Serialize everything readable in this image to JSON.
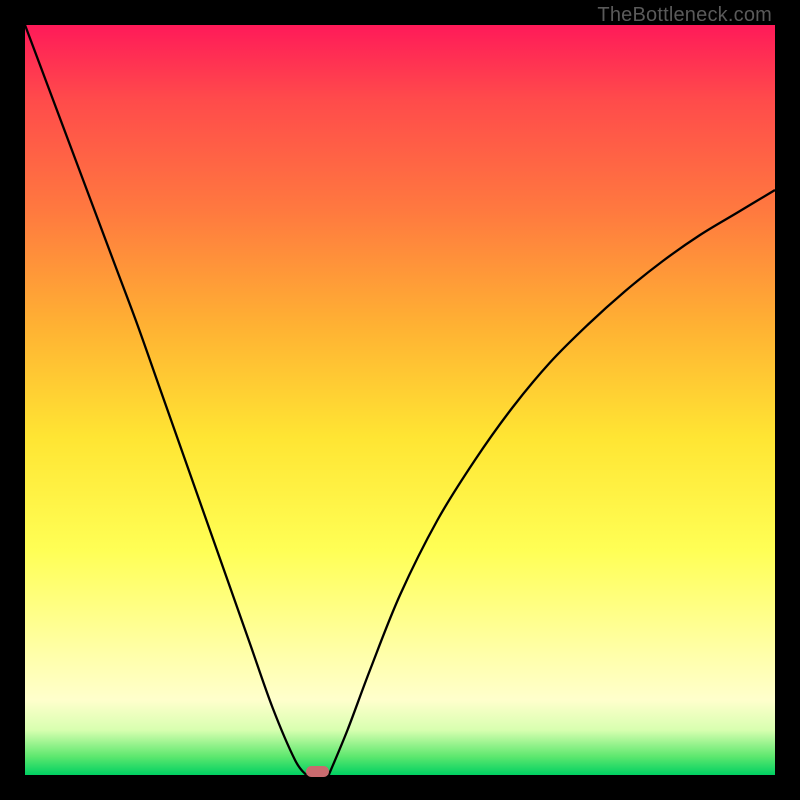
{
  "attribution": "TheBottleneck.com",
  "gradient": {
    "top": "#ff1a59",
    "mid": "#ffe533",
    "bottom": "#00d062"
  },
  "chart_data": {
    "type": "line",
    "title": "",
    "xlabel": "",
    "ylabel": "",
    "xlim": [
      0,
      100
    ],
    "ylim": [
      0,
      100
    ],
    "grid": false,
    "series": [
      {
        "name": "left-branch",
        "x": [
          0,
          3,
          6,
          9,
          12,
          15,
          18,
          21,
          24,
          27,
          30,
          33,
          36,
          37.5
        ],
        "y": [
          100,
          92,
          84,
          76,
          68,
          60,
          51.5,
          43,
          34.5,
          26,
          17.5,
          9,
          2,
          0
        ]
      },
      {
        "name": "right-branch",
        "x": [
          40.5,
          43,
          46,
          50,
          55,
          60,
          65,
          70,
          75,
          80,
          85,
          90,
          95,
          100
        ],
        "y": [
          0,
          6,
          14,
          24,
          34,
          42,
          49,
          55,
          60,
          64.5,
          68.5,
          72,
          75,
          78
        ]
      }
    ],
    "marker": {
      "x": 39,
      "y": 0.5,
      "width_pct": 3.1,
      "height_pct": 1.45,
      "color": "#c96a6e"
    }
  }
}
